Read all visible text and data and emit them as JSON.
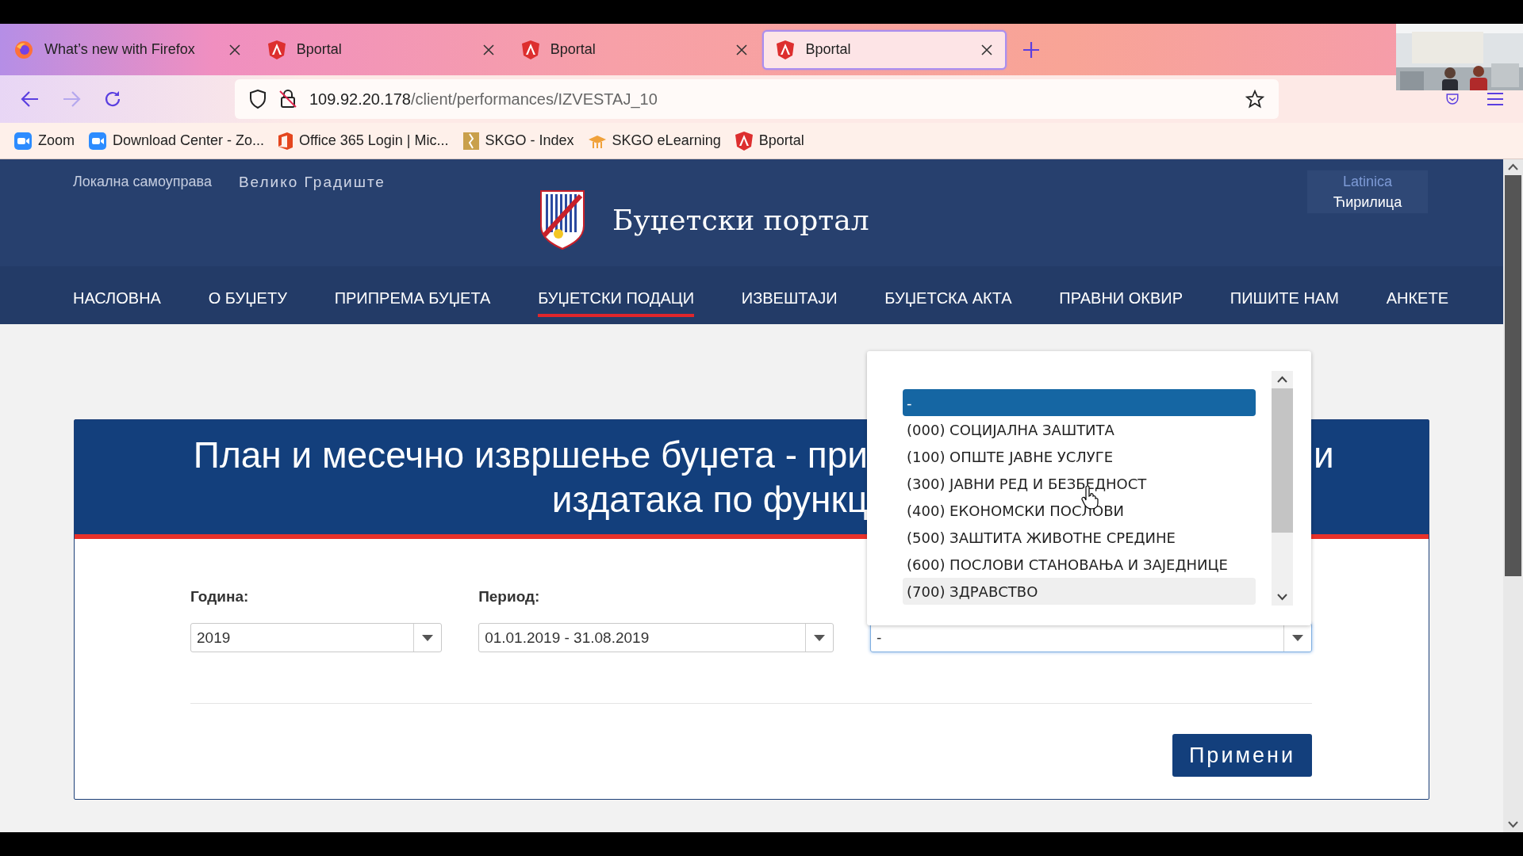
{
  "tabs": [
    {
      "title": "What’s new with Firefox",
      "kind": "firefox",
      "selected": false
    },
    {
      "title": "Bportal",
      "kind": "angular",
      "selected": false
    },
    {
      "title": "Bportal",
      "kind": "angular",
      "selected": false
    },
    {
      "title": "Bportal",
      "kind": "angular",
      "selected": true
    }
  ],
  "address": {
    "host": "109.92.20.178",
    "path": "/client/performances/IZVESTAJ_10"
  },
  "bookmarks": [
    {
      "label": "Zoom",
      "kind": "zoom"
    },
    {
      "label": "Download Center - Zo...",
      "kind": "zoom"
    },
    {
      "label": "Office 365 Login | Mic...",
      "kind": "office"
    },
    {
      "label": "SKGO - Index",
      "kind": "skgo"
    },
    {
      "label": "SKGO eLearning",
      "kind": "elearning"
    },
    {
      "label": "Bportal",
      "kind": "angular"
    }
  ],
  "site": {
    "org_label": "Локална самоуправа",
    "municipality": "Велико Градиште",
    "portal_title": "Буџетски портал",
    "languages": [
      {
        "label": "Latinica",
        "selected": false
      },
      {
        "label": "Ћирилица",
        "selected": true
      }
    ]
  },
  "nav": [
    {
      "label": "НАСЛОВНА",
      "selected": false
    },
    {
      "label": "О БУЏЕТУ",
      "selected": false
    },
    {
      "label": "ПРИПРЕМА БУЏЕТА",
      "selected": false
    },
    {
      "label": "БУЏЕТСКИ ПОДАЦИ",
      "selected": true
    },
    {
      "label": "ИЗВЕШТАЈИ",
      "selected": false
    },
    {
      "label": "БУЏЕТСКА АКТА",
      "selected": false
    },
    {
      "label": "ПРАВНИ ОКВИР",
      "selected": false
    },
    {
      "label": "ПИШИТЕ НАМ",
      "selected": false
    },
    {
      "label": "АНКЕТЕ",
      "selected": false
    }
  ],
  "report": {
    "title_line_1": "План и месечно извршење буџета - при",
    "title_line_1_end": "и",
    "title_line_2": "издатака по функц",
    "fields": [
      {
        "label": "Година:",
        "value": "2019",
        "focused": false
      },
      {
        "label": "Период:",
        "value": "01.01.2019 - 31.08.2019",
        "focused": false
      },
      {
        "value": "-",
        "focused": true
      }
    ],
    "apply_button": "Примени"
  },
  "dropdown": {
    "options": [
      {
        "label": "-",
        "selected": true,
        "hovered": false
      },
      {
        "label": "(000) СОЦИЈАЛНА ЗАШТИТА",
        "selected": false,
        "hovered": false
      },
      {
        "label": "(100) ОПШТЕ ЈАВНЕ УСЛУГЕ",
        "selected": false,
        "hovered": false
      },
      {
        "label": "(300) ЈАВНИ РЕД И БЕЗБЕДНОСТ",
        "selected": false,
        "hovered": false
      },
      {
        "label": "(400) ЕКОНОМСКИ ПОСЛОВИ",
        "selected": false,
        "hovered": false
      },
      {
        "label": "(500) ЗАШТИТА ЖИВОТНЕ СРЕДИНЕ",
        "selected": false,
        "hovered": false
      },
      {
        "label": "(600) ПОСЛОВИ СТАНОВАЊА И ЗАЈЕДНИЦЕ",
        "selected": false,
        "hovered": false
      },
      {
        "label": "(700) ЗДРАВСТВО",
        "selected": false,
        "hovered": true
      }
    ]
  }
}
